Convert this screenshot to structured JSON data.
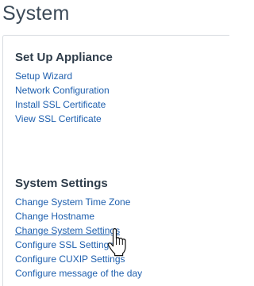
{
  "page": {
    "title": "System"
  },
  "setup_appliance": {
    "heading": "Set Up Appliance",
    "links": [
      "Setup Wizard",
      "Network Configuration",
      "Install SSL Certificate",
      "View SSL Certificate"
    ]
  },
  "system_settings": {
    "heading": "System Settings",
    "links": [
      "Change System Time Zone",
      "Change Hostname",
      "Change System Settings",
      "Configure SSL Settings",
      "Configure CUXIP Settings",
      "Configure message of the day"
    ]
  },
  "cursor": {
    "icon": "hand-pointer-icon"
  },
  "colors": {
    "title": "#3c4a58",
    "heading": "#2f3d4b",
    "link": "#1e5fae",
    "panel_border": "#d7dbe0"
  }
}
